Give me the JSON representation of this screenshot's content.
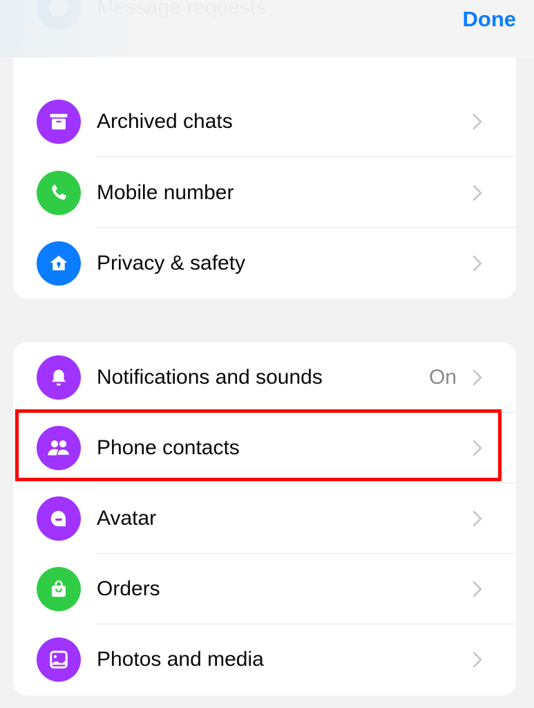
{
  "header": {
    "done_label": "Done"
  },
  "colors": {
    "accent": "#0a7cff",
    "purple": "#a033ff",
    "green": "#31cc46",
    "blue": "#0a7cff",
    "highlight": "#ff0000"
  },
  "group1": {
    "items": [
      {
        "label": "Message requests",
        "icon": "chat-bubble-icon",
        "color": "#0a7cff"
      },
      {
        "label": "Archived chats",
        "icon": "archive-box-icon",
        "color": "#a033ff"
      },
      {
        "label": "Mobile number",
        "icon": "phone-icon",
        "color": "#31cc46"
      },
      {
        "label": "Privacy & safety",
        "icon": "house-lock-icon",
        "color": "#0a7cff"
      }
    ]
  },
  "group2": {
    "items": [
      {
        "label": "Notifications and sounds",
        "value": "On",
        "icon": "bell-icon",
        "color": "#a033ff"
      },
      {
        "label": "Phone contacts",
        "icon": "people-icon",
        "color": "#a033ff",
        "highlighted": true
      },
      {
        "label": "Avatar",
        "icon": "avatar-face-icon",
        "color": "#a033ff"
      },
      {
        "label": "Orders",
        "icon": "shopping-bag-icon",
        "color": "#31cc46"
      },
      {
        "label": "Photos and media",
        "icon": "photo-icon",
        "color": "#a033ff"
      }
    ]
  }
}
